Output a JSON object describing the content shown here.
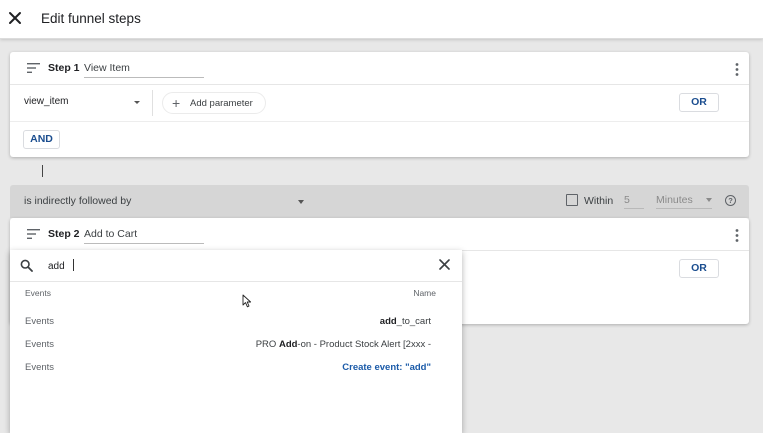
{
  "header": {
    "title": "Edit funnel steps",
    "close_icon": "close-icon"
  },
  "step1": {
    "label": "Step 1",
    "name": "View Item",
    "event": "view_item",
    "add_parameter": "Add parameter",
    "or_label": "OR",
    "and_label": "AND"
  },
  "connector": {
    "relation": "is indirectly followed by",
    "within_label": "Within",
    "within_value": "5",
    "unit": "Minutes",
    "help": "?"
  },
  "step2": {
    "label": "Step 2",
    "name": "Add to Cart",
    "or_label": "OR"
  },
  "dropdown": {
    "search_value": "add",
    "col_type": "Events",
    "col_name": "Name",
    "rows": [
      {
        "type": "Events",
        "name_bold": "add",
        "name_rest": "_to_cart"
      },
      {
        "type": "Events",
        "name_pre": "PRO ",
        "name_bold": "Add",
        "name_rest": "-on - Product Stock Alert [2xxx -"
      },
      {
        "type": "Events",
        "create": "Create event: \"add\""
      }
    ]
  },
  "colors": {
    "accent_blue": "#1a4d8f",
    "link_blue": "#1a5aa8",
    "connector_bg": "#d6d6d6"
  }
}
